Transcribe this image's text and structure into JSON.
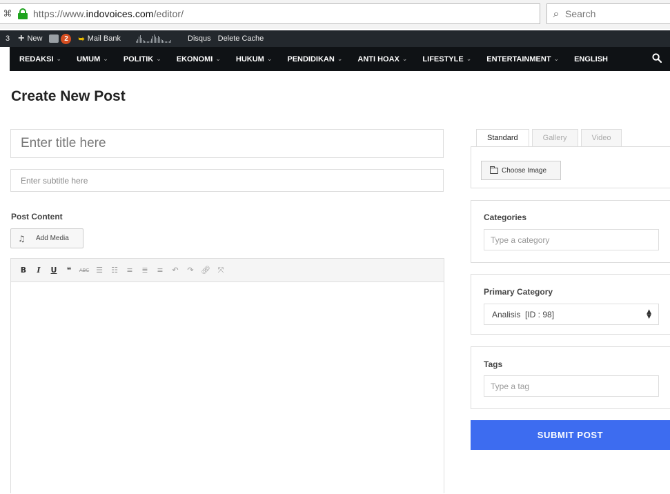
{
  "browser": {
    "url_scheme": "https://www.",
    "url_host": "indovoices.com",
    "url_path": "/editor/",
    "search_placeholder": "Search"
  },
  "admin_bar": {
    "left_count": "3",
    "new_label": "New",
    "notification_count": "2",
    "mail_bank_label": "Mail Bank",
    "disqus_label": "Disqus",
    "delete_cache_label": "Delete Cache"
  },
  "site_nav": {
    "items": [
      {
        "label": "REDAKSI",
        "has_dropdown": true
      },
      {
        "label": "UMUM",
        "has_dropdown": true
      },
      {
        "label": "POLITIK",
        "has_dropdown": true
      },
      {
        "label": "EKONOMI",
        "has_dropdown": true
      },
      {
        "label": "HUKUM",
        "has_dropdown": true
      },
      {
        "label": "PENDIDIKAN",
        "has_dropdown": true
      },
      {
        "label": "ANTI HOAX",
        "has_dropdown": true
      },
      {
        "label": "LIFESTYLE",
        "has_dropdown": true
      },
      {
        "label": "ENTERTAINMENT",
        "has_dropdown": true
      },
      {
        "label": "ENGLISH",
        "has_dropdown": false
      }
    ],
    "dropdown_glyph": "⌄"
  },
  "page": {
    "title": "Create New Post",
    "title_placeholder": "Enter title here",
    "subtitle_placeholder": "Enter subtitle here",
    "post_content_label": "Post Content",
    "add_media_label": "Add Media"
  },
  "sidebar": {
    "format_tabs": [
      {
        "label": "Standard",
        "active": true
      },
      {
        "label": "Gallery",
        "active": false
      },
      {
        "label": "Video",
        "active": false
      }
    ],
    "choose_image_label": "Choose Image",
    "categories_label": "Categories",
    "categories_placeholder": "Type a category",
    "primary_category_label": "Primary Category",
    "primary_category_value": "Analisis  [ID : 98]",
    "tags_label": "Tags",
    "tags_placeholder": "Type a tag",
    "submit_label": "SUBMIT POST"
  },
  "colors": {
    "submit_bg": "#3d6cf0",
    "nav_bg": "#0f1215",
    "admin_bar_bg": "#23282d",
    "lock_green": "#1ea31e",
    "badge_orange": "#d54e21"
  }
}
